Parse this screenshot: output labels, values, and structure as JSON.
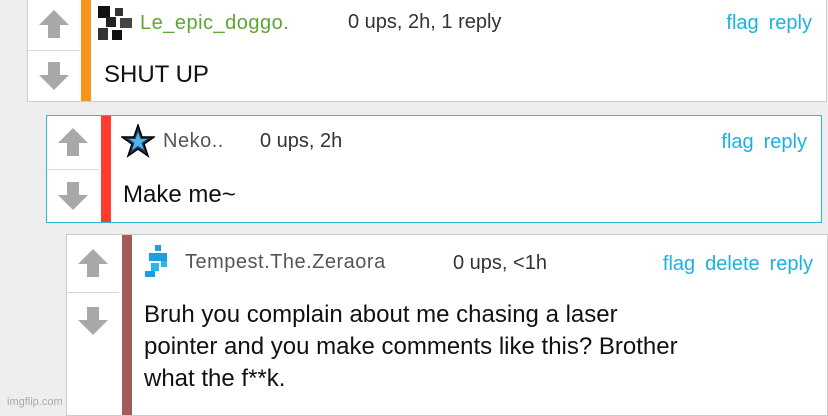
{
  "comments": [
    {
      "username": "Le_epic_doggo.",
      "username_color": "#5aa832",
      "meta": "0 ups, 2h, 1 reply",
      "actions": [
        "flag",
        "reply"
      ],
      "text": "SHUT UP",
      "bar_color": "#f7941d",
      "avatar": "checker-pixel-avatar"
    },
    {
      "username": "Neko..",
      "username_color": "#555555",
      "meta": "0 ups, 2h",
      "actions": [
        "flag",
        "reply"
      ],
      "text": "Make me~",
      "bar_color": "#ff3b30",
      "avatar": "blue-star-avatar"
    },
    {
      "username": "Tempest.The.Zeraora",
      "username_color": "#555555",
      "meta": "0 ups, <1h",
      "actions": [
        "flag",
        "delete",
        "reply"
      ],
      "text_lines": [
        "Bruh you complain about me chasing a laser",
        "pointer and you make comments like this? Brother",
        "what the f**k."
      ],
      "bar_color": "#a35a5a",
      "avatar": "blue-pixel-avatar"
    }
  ],
  "watermark": "imgflip.com",
  "colors": {
    "link": "#1bb1e3",
    "arrow": "#a8a8a8"
  }
}
